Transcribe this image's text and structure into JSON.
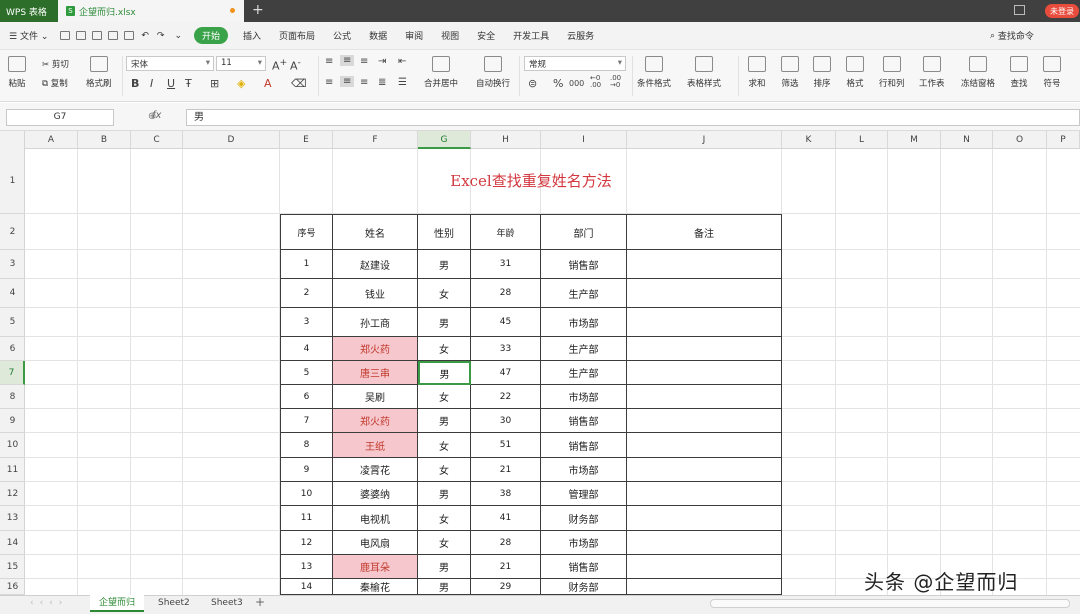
{
  "titlebar": {
    "app_tab": "WPS 表格",
    "file_tab": "企望而归.xlsx",
    "login": "未登录"
  },
  "menubar": {
    "file": "文件",
    "items": [
      "开始",
      "插入",
      "页面布局",
      "公式",
      "数据",
      "审阅",
      "视图",
      "安全",
      "开发工具",
      "云服务"
    ],
    "search": "查找命令"
  },
  "ribbon": {
    "paste": "粘贴",
    "cut": "剪切",
    "copy": "复制",
    "format_painter": "格式刷",
    "font": "宋体",
    "size": "11",
    "merge": "合并居中",
    "wrap": "自动换行",
    "numfmt": "常规",
    "percent": "%",
    "thousands": "000",
    "cond_fmt": "条件格式",
    "table_style": "表格样式",
    "sum": "求和",
    "filter": "筛选",
    "sort": "排序",
    "format": "格式",
    "rowcol": "行和列",
    "sheet": "工作表",
    "freeze": "冻结窗格",
    "find": "查找",
    "symbol": "符号"
  },
  "formula": {
    "namebox": "G7",
    "fx": "fx",
    "content": "男"
  },
  "grid": {
    "columns": [
      "A",
      "B",
      "C",
      "D",
      "E",
      "F",
      "G",
      "H",
      "I",
      "J",
      "K",
      "L",
      "M",
      "N",
      "O",
      "P"
    ],
    "rows": [
      "1",
      "2",
      "3",
      "4",
      "5",
      "6",
      "7",
      "8",
      "9",
      "10",
      "11",
      "12",
      "13",
      "14",
      "15",
      "16"
    ],
    "title": "Excel查找重复姓名方法",
    "headers": [
      "序号",
      "姓名",
      "性别",
      "年龄",
      "部门",
      "备注"
    ],
    "data": [
      [
        "1",
        "赵建设",
        "男",
        "31",
        "销售部",
        ""
      ],
      [
        "2",
        "钱业",
        "女",
        "28",
        "生产部",
        ""
      ],
      [
        "3",
        "孙工商",
        "男",
        "45",
        "市场部",
        ""
      ],
      [
        "4",
        "郑火药",
        "女",
        "33",
        "生产部",
        ""
      ],
      [
        "5",
        "唐三串",
        "男",
        "47",
        "生产部",
        ""
      ],
      [
        "6",
        "吴刷",
        "女",
        "22",
        "市场部",
        ""
      ],
      [
        "7",
        "郑火药",
        "男",
        "30",
        "销售部",
        ""
      ],
      [
        "8",
        "王纸",
        "女",
        "51",
        "销售部",
        ""
      ],
      [
        "9",
        "凌霄花",
        "女",
        "21",
        "市场部",
        ""
      ],
      [
        "10",
        "婆婆纳",
        "男",
        "38",
        "管理部",
        ""
      ],
      [
        "11",
        "电视机",
        "女",
        "41",
        "财务部",
        ""
      ],
      [
        "12",
        "电风扇",
        "女",
        "28",
        "市场部",
        ""
      ],
      [
        "13",
        "鹿耳朵",
        "男",
        "21",
        "销售部",
        ""
      ],
      [
        "14",
        "秦榆花",
        "男",
        "29",
        "财务部",
        ""
      ]
    ],
    "duplicate_rows": [
      3,
      4,
      6,
      7,
      12
    ]
  },
  "sheets": [
    "企望而归",
    "Sheet2",
    "Sheet3"
  ],
  "watermark": "头条 @企望而归",
  "colors": {
    "accent": "#3aa34a",
    "title_red": "#d2383f",
    "dup_fill": "#f7c7ce"
  }
}
